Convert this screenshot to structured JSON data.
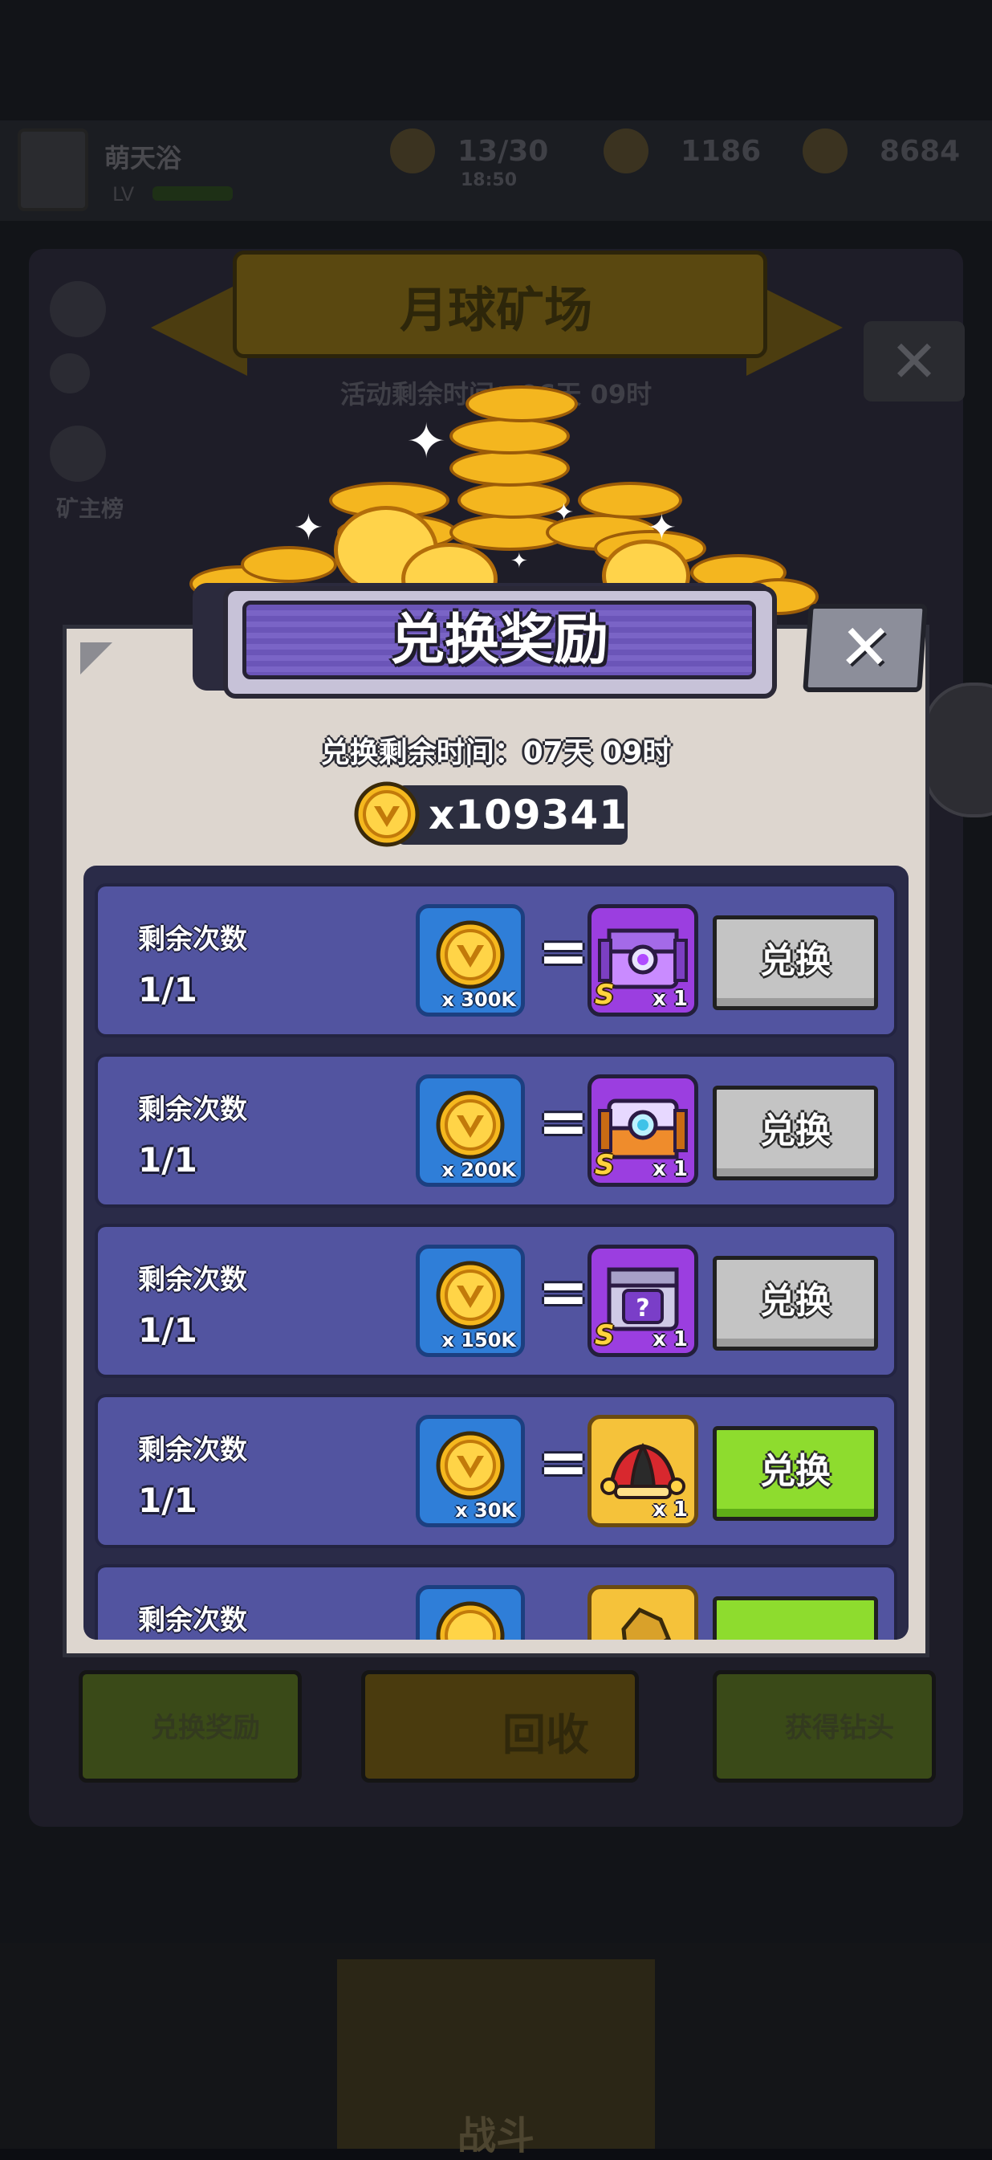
{
  "background": {
    "player_name": "萌天浴",
    "player_level": "LV",
    "stamina": "13/30",
    "stamina_timer": "18:50",
    "stat_2": "1186",
    "stat_3": "8684",
    "event_title": "月球矿场",
    "event_timer": "活动剩余时间：06天 09时",
    "side_label": "矿主榜",
    "btn_exchange": "兑换奖励",
    "btn_recycle": "回收",
    "btn_drill": "获得钻头",
    "nav_battle": "战斗",
    "close_glyph": "✕"
  },
  "modal": {
    "title": "兑换奖励",
    "close_glyph": "✕",
    "timer": "兑换剩余时间：07天 09时",
    "balance": "x109341"
  },
  "rows": [
    {
      "label": "剩余次数",
      "count": "1/1",
      "cost": "x 300K",
      "equals": "=",
      "reward_qty": "x 1",
      "reward_rarity": "S",
      "reward_icon": "purple-chest-icon",
      "button": "兑换",
      "button_state": "disabled"
    },
    {
      "label": "剩余次数",
      "count": "1/1",
      "cost": "x 200K",
      "equals": "=",
      "reward_qty": "x 1",
      "reward_rarity": "S",
      "reward_icon": "orange-chest-icon",
      "button": "兑换",
      "button_state": "disabled"
    },
    {
      "label": "剩余次数",
      "count": "1/1",
      "cost": "x 150K",
      "equals": "=",
      "reward_qty": "x 1",
      "reward_rarity": "S",
      "reward_icon": "mystery-chest-icon",
      "button": "兑换",
      "button_state": "disabled"
    },
    {
      "label": "剩余次数",
      "count": "1/1",
      "cost": "x 30K",
      "equals": "=",
      "reward_qty": "x 1",
      "reward_rarity": "",
      "reward_icon": "jester-hat-icon",
      "button": "兑换",
      "button_state": "enabled"
    },
    {
      "label": "剩余次数",
      "count": "",
      "cost": "",
      "equals": "",
      "reward_qty": "",
      "reward_rarity": "",
      "reward_icon": "gold-ore-icon",
      "button": "",
      "button_state": "enabled"
    }
  ],
  "colors": {
    "button_enabled": "#8edc2e",
    "button_disabled": "#c4c4c4",
    "row_bg": "#5254a0",
    "cost_tile": "#2f7ed8",
    "reward_purple": "#9b3ee0",
    "reward_gold": "#f5c23a"
  }
}
